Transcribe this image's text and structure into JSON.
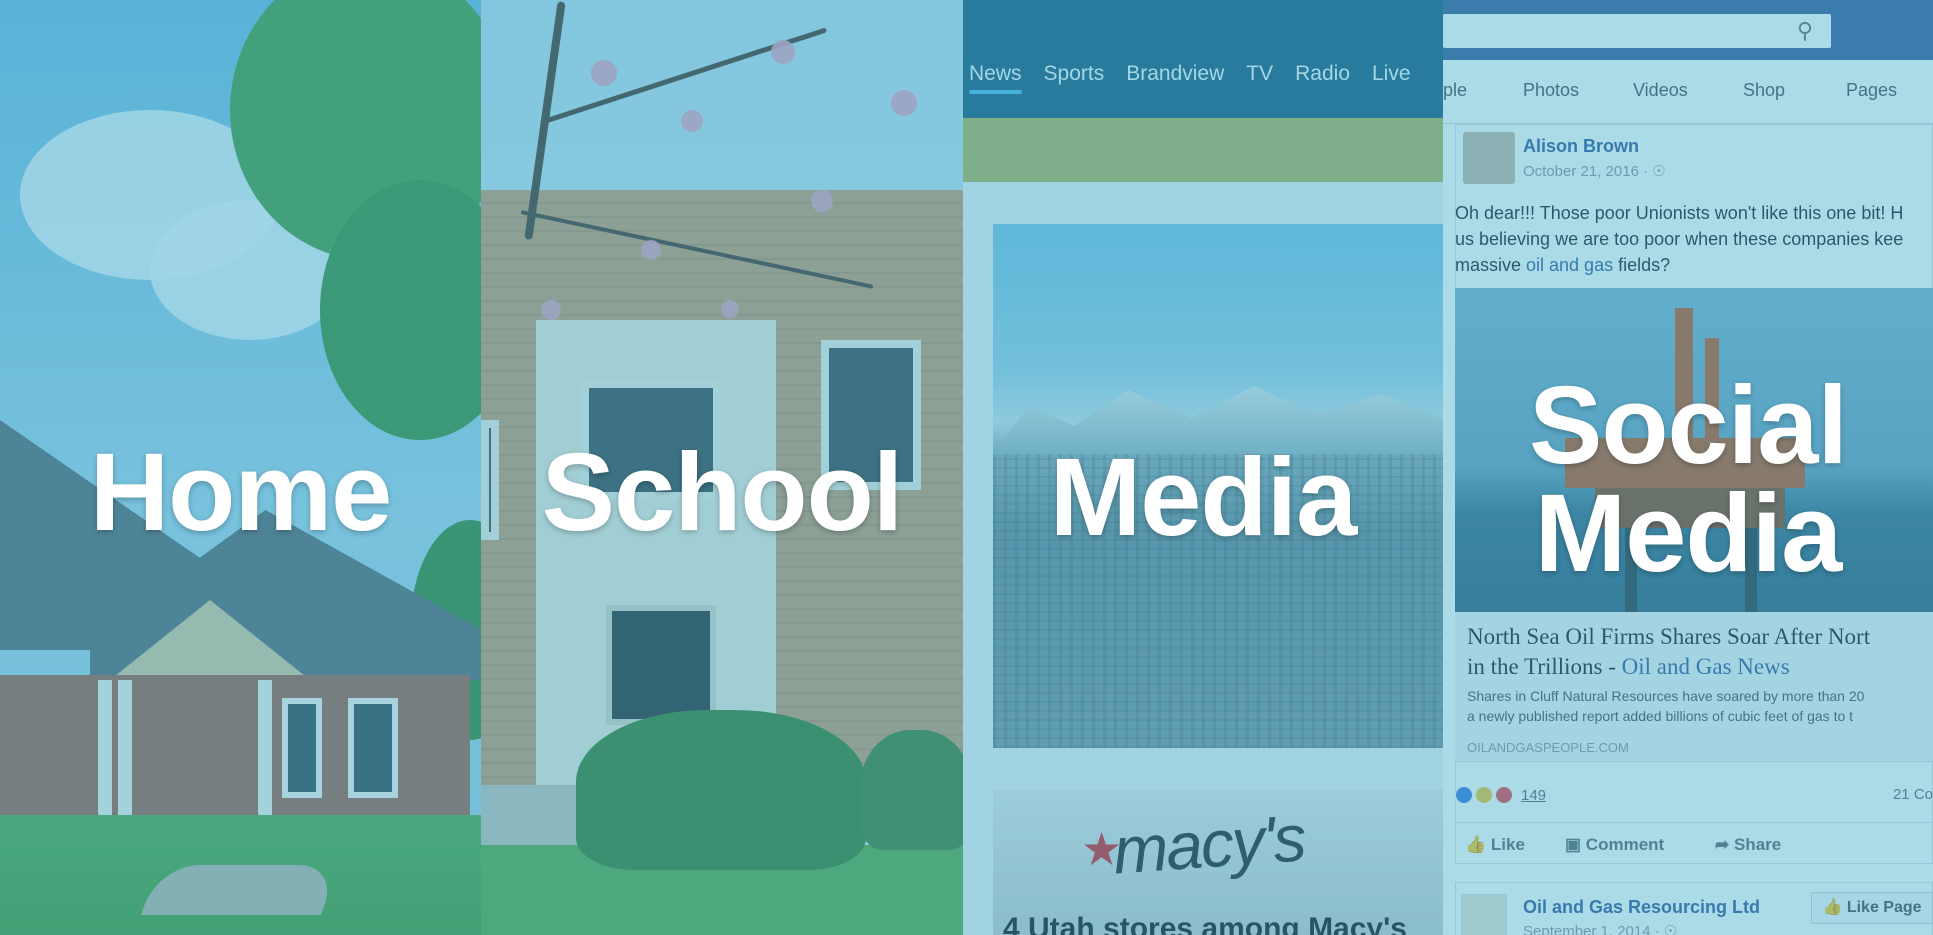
{
  "panels": {
    "home": {
      "label": "Home"
    },
    "school": {
      "label": "School"
    },
    "media": {
      "label": "Media",
      "nav": [
        "News",
        "Sports",
        "Brandview",
        "TV",
        "Radio",
        "Live"
      ],
      "store_logo": "macy's",
      "headline_partial": "4 Utah stores among Macy's"
    },
    "social": {
      "label_line1": "Social",
      "label_line2": "Media",
      "tabs": [
        "ple",
        "Photos",
        "Videos",
        "Shop",
        "Pages"
      ],
      "post": {
        "author": "Alison Brown",
        "date": "October 21, 2016 · ",
        "text_1": "Oh dear!!! Those poor Unionists won't like this one bit! H",
        "text_2": "us believing we are too poor when these companies kee",
        "text_3": "massive ",
        "text_hl": "oil and gas",
        "text_4": " fields?",
        "headline_1": "North Sea Oil Firms Shares Soar After Nort",
        "headline_2": "in the Trillions - ",
        "headline_hl": "Oil and Gas News",
        "desc_1": "Shares in Cluff Natural Resources have soared by more than 20",
        "desc_2": "a newly published report added billions of cubic feet of gas to t",
        "domain": "OILANDGASPEOPLE.COM",
        "reactions_count": "149",
        "comments": "21 Co",
        "actions": [
          "Like",
          "Comment",
          "Share"
        ]
      },
      "post2": {
        "author": "Oil and Gas Resourcing Ltd",
        "date": "September 1, 2014 · ",
        "like_page": "Like Page"
      }
    }
  },
  "colors": {
    "overlay": "#3aaac8",
    "facebook_blue": "#3e5c98",
    "media_nav": "#1d5a7e"
  }
}
